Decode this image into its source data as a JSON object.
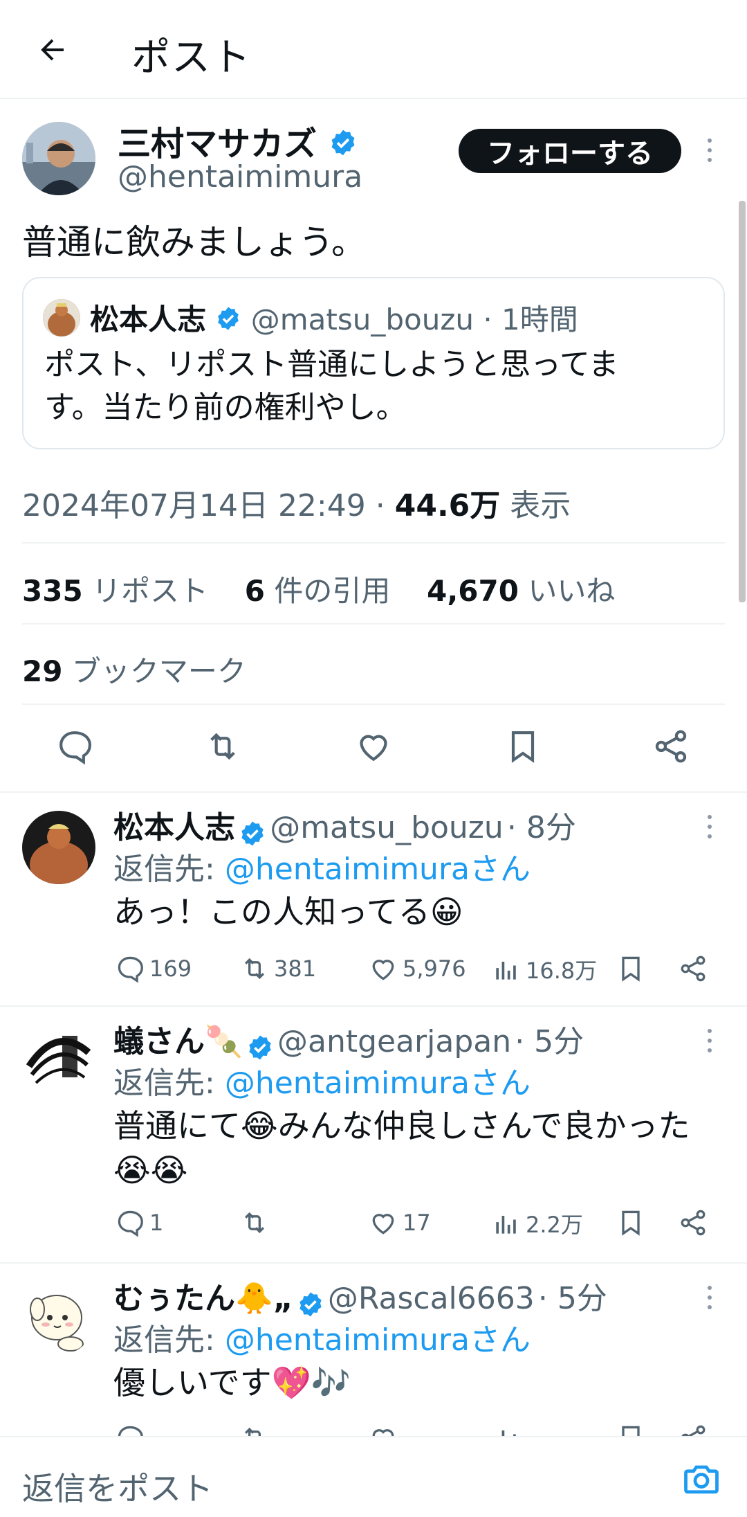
{
  "header": {
    "title": "ポスト"
  },
  "post": {
    "author_name": "三村マサカズ",
    "author_handle": "@hentaimimura",
    "follow_label": "フォローする",
    "text": "普通に飲みましょう。",
    "quote": {
      "author_name": "松本人志",
      "author_handle": "@matsu_bouzu",
      "time": "· 1時間",
      "text_line1": "ポスト、リポスト普通にしようと思ってま",
      "text_line2": "す。当たり前の権利やし。"
    },
    "timestamp": "2024年07月14日 22:49 ·",
    "views_count": "44.6万",
    "views_label": "表示",
    "reposts_count": "335",
    "reposts_label": "リポスト",
    "quotes_count": "6",
    "quotes_label": "件の引用",
    "likes_count": "4,670",
    "likes_label": "いいね",
    "bookmarks_count": "29",
    "bookmarks_label": "ブックマーク"
  },
  "replies": [
    {
      "name": "松本人志",
      "handle": "@matsu_bouzu",
      "time": "· 8分",
      "reply_to_prefix": "返信先:",
      "reply_to_handle": "@hentaimimuraさん",
      "text_line1": "あっ！この人知ってる😀",
      "text_line2": "",
      "replies": "169",
      "reposts": "381",
      "likes": "5,976",
      "views": "16.8万"
    },
    {
      "name": "蟻さん🍡",
      "handle": "@antgearjapan",
      "time": "· 5分",
      "reply_to_prefix": "返信先:",
      "reply_to_handle": "@hentaimimuraさん",
      "text_line1": "普通にて😂みんな仲良しさんで良かった",
      "text_line2": "😭😭",
      "replies": "1",
      "reposts": "",
      "likes": "17",
      "views": "2.2万"
    },
    {
      "name": "むぅたん🐥„",
      "handle": "@Rascal6663",
      "time": "· 5分",
      "reply_to_prefix": "返信先:",
      "reply_to_handle": "@hentaimimuraさん",
      "text_line1": "優しいです💖🎶",
      "text_line2": "",
      "replies": "",
      "reposts": "",
      "likes": "",
      "views": ""
    }
  ],
  "compose": {
    "placeholder": "返信をポスト"
  },
  "colors": {
    "accent": "#1d9bf0",
    "text": "#0f1419",
    "muted": "#536471",
    "divider": "#eff3f4"
  }
}
